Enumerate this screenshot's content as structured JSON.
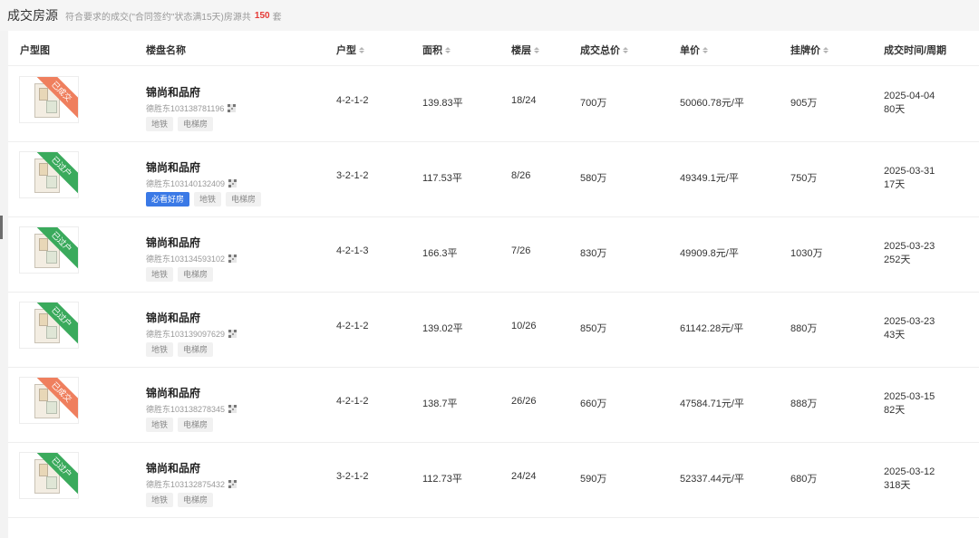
{
  "topbar": {
    "title": "成交房源",
    "subtitle": "符合要求的成交(\"合同签约\"状态满15天)房源共",
    "count": "150",
    "count_unit": "套"
  },
  "colors": {
    "ribbon_sold": "#ef7f5e",
    "ribbon_transfer": "#3aaa5c",
    "tag_hot": "#3a79e6",
    "count": "#e53935"
  },
  "table": {
    "headers": {
      "floorplan": "户型图",
      "estate": "楼盘名称",
      "layout": "户型",
      "area": "面积",
      "floor": "楼层",
      "total": "成交总价",
      "unit_price": "单价",
      "list_price": "挂牌价",
      "deal_time": "成交时间/周期"
    },
    "rows": [
      {
        "ribbon": "已成交",
        "ribbon_type": "sold",
        "name": "锦尚和品府",
        "code": "德胜东103138781196",
        "tags": [
          "地铁",
          "电梯房"
        ],
        "layout": "4-2-1-2",
        "area": "139.83平",
        "floor": "18/24",
        "total": "700万",
        "unit_price": "50060.78元/平",
        "list_price": "905万",
        "date": "2025-04-04",
        "period": "80天"
      },
      {
        "ribbon": "已过户",
        "ribbon_type": "transfer",
        "name": "锦尚和品府",
        "code": "德胜东103140132409",
        "tags": [
          "必看好房",
          "地铁",
          "电梯房"
        ],
        "layout": "3-2-1-2",
        "area": "117.53平",
        "floor": "8/26",
        "total": "580万",
        "unit_price": "49349.1元/平",
        "list_price": "750万",
        "date": "2025-03-31",
        "period": "17天"
      },
      {
        "ribbon": "已过户",
        "ribbon_type": "transfer",
        "name": "锦尚和品府",
        "code": "德胜东103134593102",
        "tags": [
          "地铁",
          "电梯房"
        ],
        "layout": "4-2-1-3",
        "area": "166.3平",
        "floor": "7/26",
        "total": "830万",
        "unit_price": "49909.8元/平",
        "list_price": "1030万",
        "date": "2025-03-23",
        "period": "252天"
      },
      {
        "ribbon": "已过户",
        "ribbon_type": "transfer",
        "name": "锦尚和品府",
        "code": "德胜东103139097629",
        "tags": [
          "地铁",
          "电梯房"
        ],
        "layout": "4-2-1-2",
        "area": "139.02平",
        "floor": "10/26",
        "total": "850万",
        "unit_price": "61142.28元/平",
        "list_price": "880万",
        "date": "2025-03-23",
        "period": "43天"
      },
      {
        "ribbon": "已成交",
        "ribbon_type": "sold",
        "name": "锦尚和品府",
        "code": "德胜东103138278345",
        "tags": [
          "地铁",
          "电梯房"
        ],
        "layout": "4-2-1-2",
        "area": "138.7平",
        "floor": "26/26",
        "total": "660万",
        "unit_price": "47584.71元/平",
        "list_price": "888万",
        "date": "2025-03-15",
        "period": "82天"
      },
      {
        "ribbon": "已过户",
        "ribbon_type": "transfer",
        "name": "锦尚和品府",
        "code": "德胜东103132875432",
        "tags": [
          "地铁",
          "电梯房"
        ],
        "layout": "3-2-1-2",
        "area": "112.73平",
        "floor": "24/24",
        "total": "590万",
        "unit_price": "52337.44元/平",
        "list_price": "680万",
        "date": "2025-03-12",
        "period": "318天"
      }
    ]
  }
}
